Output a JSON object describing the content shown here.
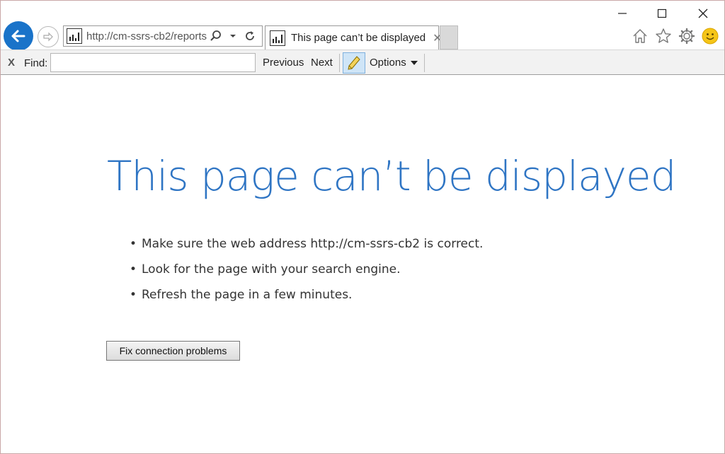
{
  "window": {
    "minimize_icon": "minimize-icon",
    "maximize_icon": "maximize-icon",
    "close_icon": "close-icon"
  },
  "addressbar": {
    "url": "http://cm-ssrs-cb2/reports",
    "back_icon": "back-arrow-icon",
    "forward_icon": "forward-arrow-icon",
    "search_icon": "search-icon",
    "dropdown_icon": "chevron-down-icon",
    "refresh_icon": "refresh-icon"
  },
  "tab": {
    "title": "This page can’t be displayed",
    "close_label": "✕"
  },
  "toolbar_icons": [
    "home-icon",
    "favorites-star-icon",
    "settings-gear-icon",
    "feedback-smiley-icon"
  ],
  "findbar": {
    "close_label": "X",
    "find_label": "Find:",
    "find_value": "",
    "previous_label": "Previous",
    "next_label": "Next",
    "options_label": "Options"
  },
  "error_page": {
    "title": "This page can’t be displayed",
    "suggestions": [
      "Make sure the web address http://cm-ssrs-cb2 is correct.",
      "Look for the page with your search engine.",
      "Refresh the page in a few minutes."
    ],
    "fix_button_label": "Fix connection problems"
  },
  "colors": {
    "accent": "#2f75c4",
    "back_button": "#1a73c9",
    "highlight": "#cfe5f7",
    "smiley": "#f5c518"
  }
}
